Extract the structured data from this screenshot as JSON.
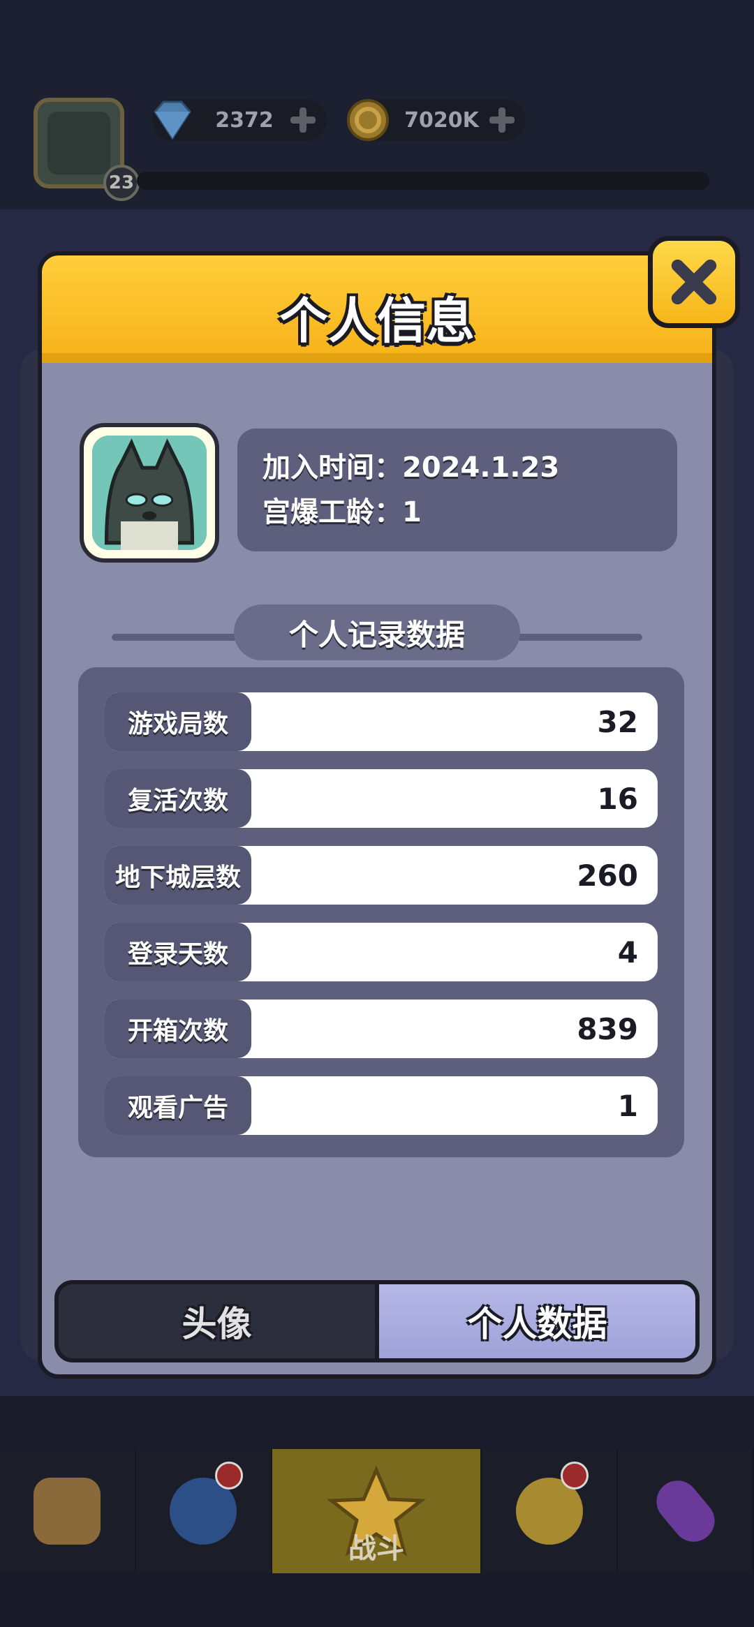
{
  "hud": {
    "level": "23",
    "gems": "2372",
    "gold": "7020K"
  },
  "modal": {
    "title": "个人信息",
    "join_date": "加入时间：2024.1.23",
    "service_years": "宫爆工龄：1",
    "section_title": "个人记录数据",
    "stats": [
      {
        "label": "游戏局数",
        "value": "32"
      },
      {
        "label": "复活次数",
        "value": "16"
      },
      {
        "label": "地下城层数",
        "value": "260"
      },
      {
        "label": "登录天数",
        "value": "4"
      },
      {
        "label": "开箱次数",
        "value": "839"
      },
      {
        "label": "观看广告",
        "value": "1"
      }
    ],
    "tabs": [
      {
        "label": "头像",
        "active": false
      },
      {
        "label": "个人数据",
        "active": true
      }
    ]
  },
  "bottom_nav": {
    "battle_label": "战斗"
  },
  "colors": {
    "header_yellow": "#f7b21a",
    "panel_bg": "#8a8da9",
    "box_bg": "#5d5f7d",
    "active_tab": "#a7aadc"
  }
}
